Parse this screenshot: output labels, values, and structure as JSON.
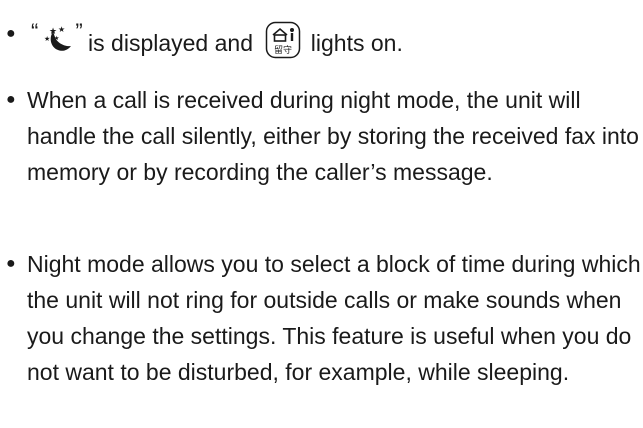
{
  "items": [
    {
      "open_quote": "“",
      "close_quote": "”",
      "moon_icon": "night-mode-moon-icon",
      "text_a": " is displayed and ",
      "answer_icon": "auto-answer-button-icon",
      "answer_icon_text": "留守",
      "text_b": " lights on."
    },
    {
      "text": "When a call is received during night mode, the unit will handle the call silently, either by storing the received fax into memory or by recording the caller’s message."
    },
    {
      "text": "Night mode allows you to select a block of time during which the unit will not ring for outside calls or make sounds when you change the settings. This feature is useful when you do not want to be disturbed, for example, while sleeping."
    }
  ],
  "bullet_char": "●",
  "colors": {
    "text": "#1a1a1a",
    "icon_stroke": "#1a1a1a"
  }
}
